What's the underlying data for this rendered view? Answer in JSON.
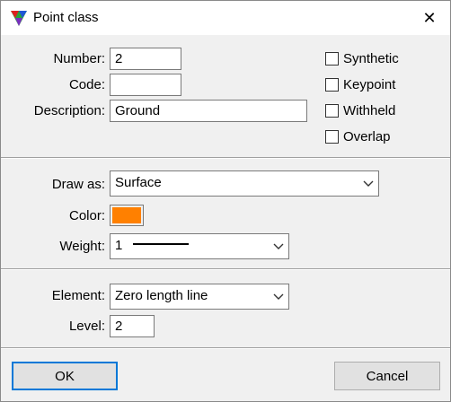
{
  "window": {
    "title": "Point class",
    "close_glyph": "✕"
  },
  "top": {
    "number_label": "Number:",
    "number_value": "2",
    "code_label": "Code:",
    "code_value": "",
    "description_label": "Description:",
    "description_value": "Ground",
    "checkboxes": [
      {
        "label": "Synthetic",
        "checked": false
      },
      {
        "label": "Keypoint",
        "checked": false
      },
      {
        "label": "Withheld",
        "checked": false
      },
      {
        "label": "Overlap",
        "checked": false
      }
    ]
  },
  "draw": {
    "draw_as_label": "Draw as:",
    "draw_as_value": "Surface",
    "color_label": "Color:",
    "color_value": "#ff8000",
    "weight_label": "Weight:",
    "weight_value": "1"
  },
  "element": {
    "element_label": "Element:",
    "element_value": "Zero length line",
    "level_label": "Level:",
    "level_value": "2"
  },
  "buttons": {
    "ok": "OK",
    "cancel": "Cancel"
  },
  "icons": {
    "app": "terrasolid-triangle-icon",
    "dropdown": "chevron-down-icon",
    "close": "close-icon"
  }
}
